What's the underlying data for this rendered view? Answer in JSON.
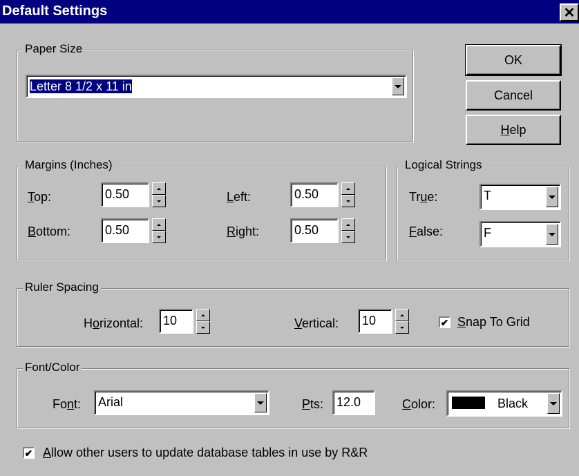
{
  "window": {
    "title": "Default Settings",
    "close_glyph": "✕"
  },
  "buttons": {
    "ok": "OK",
    "cancel": "Cancel",
    "help_u": "H",
    "help_rest": "elp"
  },
  "paper_size": {
    "legend": "Paper Size",
    "value": "Letter 8 1/2 x 11 in"
  },
  "margins": {
    "legend": "Margins (Inches)",
    "top": {
      "u": "T",
      "rest": "op:",
      "value": "0.50"
    },
    "bottom": {
      "u": "B",
      "rest": "ottom:",
      "value": "0.50"
    },
    "left": {
      "u": "L",
      "rest": "eft:",
      "value": "0.50"
    },
    "right": {
      "u": "R",
      "rest": "ight:",
      "value": "0.50"
    }
  },
  "logical_strings": {
    "legend": "Logical Strings",
    "true": {
      "pre": "Tr",
      "u": "u",
      "rest": "e:",
      "value": "T"
    },
    "false": {
      "u": "F",
      "rest": "alse:",
      "value": "F"
    }
  },
  "ruler_spacing": {
    "legend": "Ruler Spacing",
    "horizontal": {
      "pre": "H",
      "u": "o",
      "rest": "rizontal:",
      "value": "10"
    },
    "vertical": {
      "u": "V",
      "rest": "ertical:",
      "value": "10"
    },
    "snap": {
      "u": "S",
      "rest": "nap To Grid",
      "checked": true
    }
  },
  "font_color": {
    "legend": "Font/Color",
    "font": {
      "pre": "Fo",
      "u": "n",
      "rest": "t:",
      "value": "Arial"
    },
    "pts": {
      "u": "P",
      "rest": "ts:",
      "value": "12.0"
    },
    "color": {
      "u": "C",
      "rest": "olor:",
      "value": "Black",
      "swatch": "#000000"
    }
  },
  "allow_update": {
    "u": "A",
    "rest": "llow other users to update database tables in use by R&R",
    "checked": true
  },
  "check_mark": "✔"
}
